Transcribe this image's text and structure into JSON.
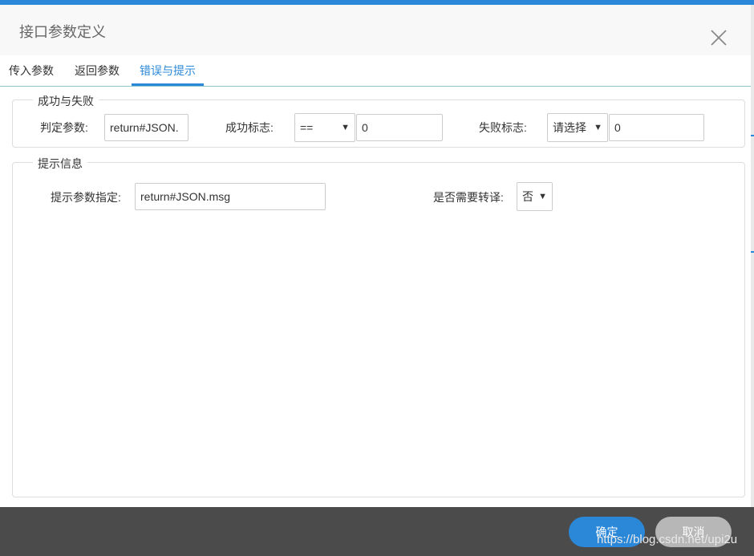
{
  "dialog": {
    "title": "接口参数定义",
    "close_icon": "close-icon"
  },
  "tabs": [
    {
      "label": "传入参数",
      "active": false
    },
    {
      "label": "返回参数",
      "active": false
    },
    {
      "label": "错误与提示",
      "active": true
    }
  ],
  "success_fail": {
    "legend": "成功与失败",
    "judge_label": "判定参数:",
    "judge_value": "return#JSON.",
    "success_label": "成功标志:",
    "success_operator": "==",
    "success_value": "0",
    "fail_label": "失败标志:",
    "fail_operator": "请选择",
    "fail_value": "0"
  },
  "hint": {
    "legend": "提示信息",
    "param_label": "提示参数指定:",
    "param_value": "return#JSON.msg",
    "escape_label": "是否需要转译:",
    "escape_value": "否"
  },
  "footer": {
    "ok_label": "确定",
    "cancel_label": "取消",
    "watermark": "https://blog.csdn.net/upi2u"
  },
  "colors": {
    "accent": "#2b88d8",
    "footer_bg": "#4b4b4b",
    "cancel_bg": "#b7b7b7"
  }
}
